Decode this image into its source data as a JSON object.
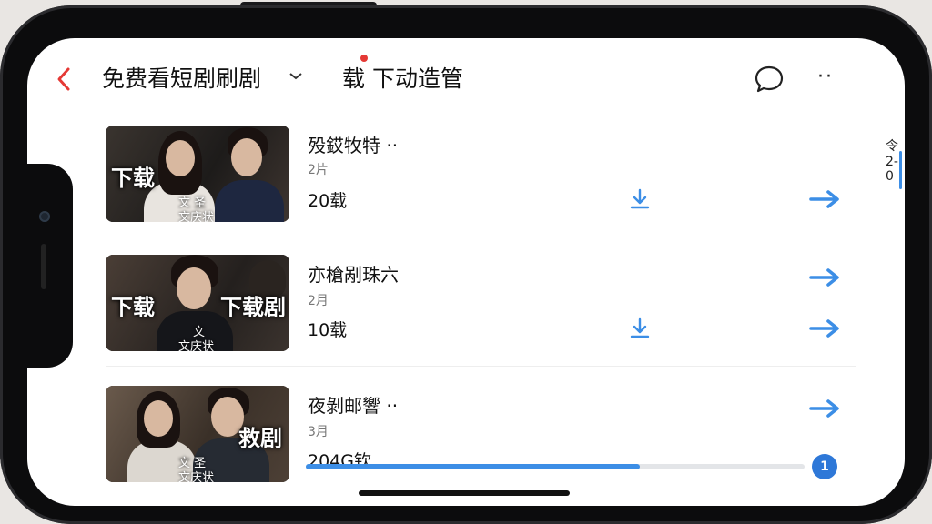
{
  "header": {
    "back_icon": "chevron-left-icon",
    "title": "免费看短剧刷剧",
    "title_caret_icon": "chevron-down-icon",
    "subtitle": "载 下动造管",
    "chat_icon": "speech-bubble-icon",
    "more_icon": "more-dots-icon",
    "more_label": "··"
  },
  "colors": {
    "accent": "#3c8ee6",
    "back": "#e53935",
    "progress_fill": "#3c8ee6"
  },
  "rows": [
    {
      "thumb_overlay_left": "下载",
      "thumb_overlay_right": "",
      "thumb_caption_top": "文 圣",
      "thumb_caption_bottom": "文庆状",
      "name": "殁銰牧特 ··",
      "sub": "2片",
      "count": "20载",
      "right_top": "令2-0",
      "download_icon": "download-icon",
      "arrow_icon": "arrow-right-icon"
    },
    {
      "thumb_overlay_left": "下载",
      "thumb_overlay_right": "下载剧",
      "thumb_caption_top": "文",
      "thumb_caption_bottom": "文庆状",
      "name": "亦槍剐珠六",
      "sub": "2月",
      "count": "10载",
      "download_icon": "download-icon",
      "arrow_icon": "arrow-right-icon"
    },
    {
      "thumb_overlay_left": "",
      "thumb_overlay_right": "救剧",
      "thumb_caption_top": "文 圣",
      "thumb_caption_bottom": "文庆状",
      "name": "夜剝邮響 ··",
      "sub": "3月",
      "count": "204G钦",
      "progress": 0.67,
      "knob_label": "1",
      "arrow_icon": "arrow-right-icon"
    }
  ]
}
